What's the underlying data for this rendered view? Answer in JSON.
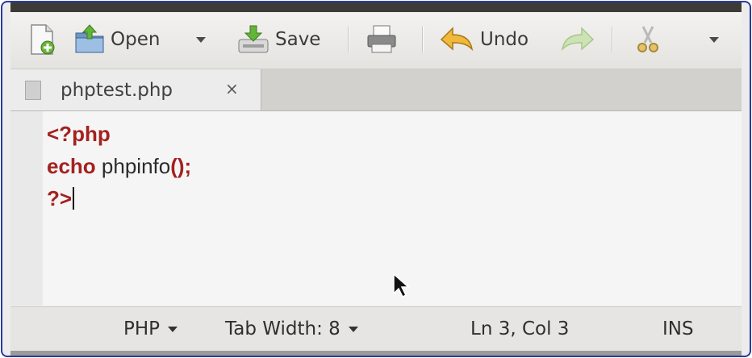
{
  "toolbar": {
    "new_icon": "new-document-icon",
    "open_label": "Open",
    "open_icon": "open-folder-icon",
    "save_label": "Save",
    "save_icon": "save-icon",
    "print_icon": "print-icon",
    "undo_label": "Undo",
    "undo_icon": "undo-arrow-icon",
    "redo_icon": "redo-arrow-icon",
    "cut_icon": "scissors-icon"
  },
  "tabs": [
    {
      "label": "phptest.php",
      "close": "×"
    }
  ],
  "editor": {
    "lines": [
      {
        "keyword": "<?php",
        "rest": ""
      },
      {
        "keyword": "echo",
        "rest": " phpinfo",
        "punct": "();"
      },
      {
        "keyword": "?>",
        "rest": ""
      }
    ]
  },
  "statusbar": {
    "language": "PHP",
    "tab_width": "Tab Width: 8",
    "position": "Ln 3, Col 3",
    "mode": "INS"
  },
  "colors": {
    "keyword": "#a3211f",
    "frame_border": "#2b3c9e"
  }
}
